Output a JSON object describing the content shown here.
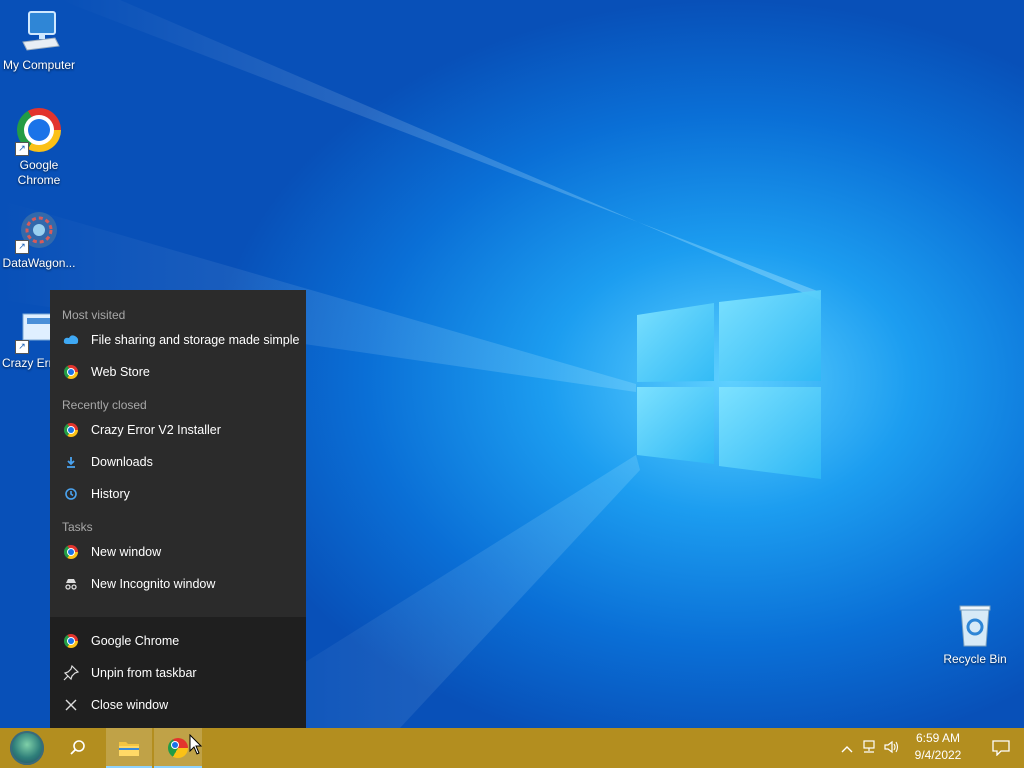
{
  "desktop": {
    "icons": [
      {
        "label": "My Computer"
      },
      {
        "label": "Google Chrome"
      },
      {
        "label": "DataWagon..."
      },
      {
        "label": "Crazy Error"
      },
      {
        "label": "Recycle Bin"
      }
    ]
  },
  "jumplist": {
    "most_visited": {
      "header": "Most visited",
      "items": [
        {
          "label": "File sharing and storage made simple",
          "icon": "cloud-icon"
        },
        {
          "label": "Web Store",
          "icon": "chrome-icon"
        }
      ]
    },
    "recently_closed": {
      "header": "Recently closed",
      "items": [
        {
          "label": "Crazy Error V2 Installer",
          "icon": "chrome-icon"
        },
        {
          "label": "Downloads",
          "icon": "download-icon"
        },
        {
          "label": "History",
          "icon": "history-icon"
        }
      ]
    },
    "tasks": {
      "header": "Tasks",
      "items": [
        {
          "label": "New window",
          "icon": "chrome-icon"
        },
        {
          "label": "New Incognito window",
          "icon": "incognito-icon"
        }
      ]
    },
    "actions": [
      {
        "label": "Google Chrome",
        "icon": "chrome-icon"
      },
      {
        "label": "Unpin from taskbar",
        "icon": "unpin-icon"
      },
      {
        "label": "Close window",
        "icon": "close-icon"
      }
    ]
  },
  "taskbar": {
    "clock": {
      "time": "6:59 AM",
      "date": "9/4/2022"
    },
    "colors": {
      "taskbar": "#b38e1f",
      "menu_bg": "#2b2b2b",
      "menu_footer_bg": "#1f1f1f",
      "accent": "#8fd3ff"
    }
  }
}
